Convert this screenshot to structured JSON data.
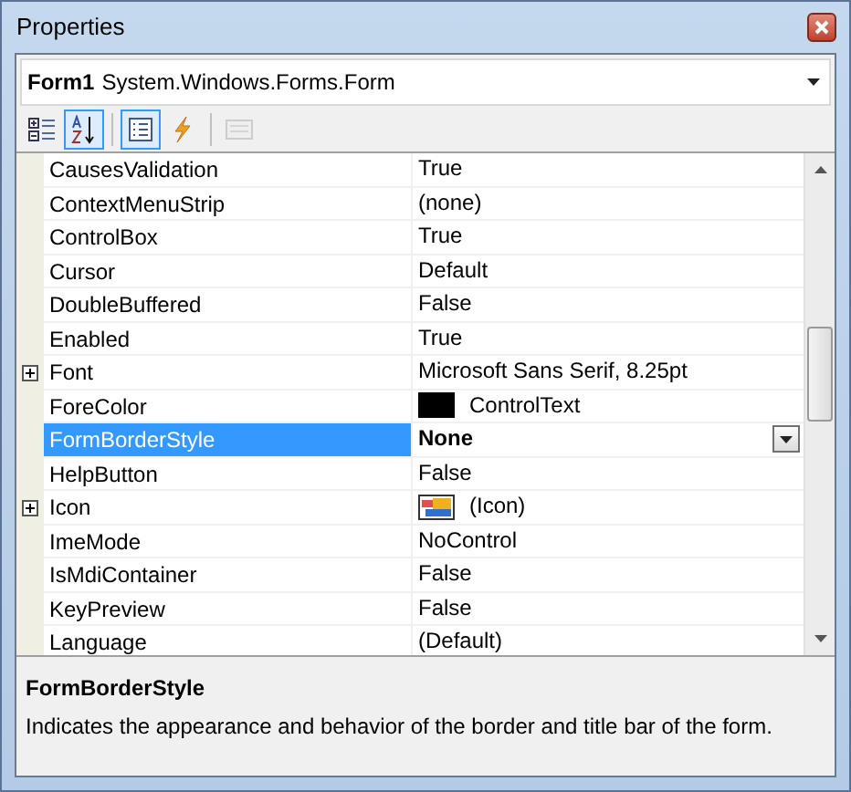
{
  "window": {
    "title": "Properties"
  },
  "object_selector": {
    "name": "Form1",
    "type": "System.Windows.Forms.Form"
  },
  "toolbar": [
    {
      "kind": "categorized",
      "selected": false,
      "disabled": false
    },
    {
      "kind": "alphabetical",
      "selected": true,
      "disabled": false
    },
    {
      "kind": "properties",
      "selected": true,
      "disabled": false
    },
    {
      "kind": "events",
      "selected": false,
      "disabled": false
    },
    {
      "kind": "pages",
      "selected": false,
      "disabled": true
    }
  ],
  "properties": [
    {
      "name": "CausesValidation",
      "value": "True",
      "kind": "text",
      "expandable": false,
      "selected": false,
      "modified": false
    },
    {
      "name": "ContextMenuStrip",
      "value": "(none)",
      "kind": "text",
      "expandable": false,
      "selected": false,
      "modified": false
    },
    {
      "name": "ControlBox",
      "value": "True",
      "kind": "text",
      "expandable": false,
      "selected": false,
      "modified": false
    },
    {
      "name": "Cursor",
      "value": "Default",
      "kind": "text",
      "expandable": false,
      "selected": false,
      "modified": false
    },
    {
      "name": "DoubleBuffered",
      "value": "False",
      "kind": "text",
      "expandable": false,
      "selected": false,
      "modified": false
    },
    {
      "name": "Enabled",
      "value": "True",
      "kind": "text",
      "expandable": false,
      "selected": false,
      "modified": false
    },
    {
      "name": "Font",
      "value": "Microsoft Sans Serif, 8.25pt",
      "kind": "text",
      "expandable": true,
      "selected": false,
      "modified": false
    },
    {
      "name": "ForeColor",
      "value": "ControlText",
      "kind": "color",
      "expandable": false,
      "selected": false,
      "modified": false
    },
    {
      "name": "FormBorderStyle",
      "value": "None",
      "kind": "text",
      "expandable": false,
      "selected": true,
      "modified": true
    },
    {
      "name": "HelpButton",
      "value": "False",
      "kind": "text",
      "expandable": false,
      "selected": false,
      "modified": false
    },
    {
      "name": "Icon",
      "value": "(Icon)",
      "kind": "icon",
      "expandable": true,
      "selected": false,
      "modified": false
    },
    {
      "name": "ImeMode",
      "value": "NoControl",
      "kind": "text",
      "expandable": false,
      "selected": false,
      "modified": false
    },
    {
      "name": "IsMdiContainer",
      "value": "False",
      "kind": "text",
      "expandable": false,
      "selected": false,
      "modified": false
    },
    {
      "name": "KeyPreview",
      "value": "False",
      "kind": "text",
      "expandable": false,
      "selected": false,
      "modified": false
    },
    {
      "name": "Language",
      "value": "(Default)",
      "kind": "text",
      "expandable": false,
      "selected": false,
      "modified": false
    }
  ],
  "description": {
    "title": "FormBorderStyle",
    "text": "Indicates the appearance and behavior of the border and title bar of the form."
  }
}
